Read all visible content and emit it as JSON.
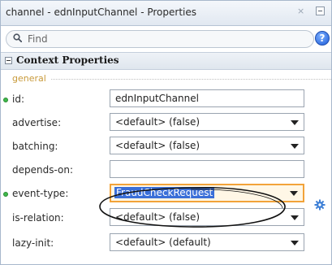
{
  "window": {
    "title": "channel - ednInputChannel - Properties",
    "close_glyph": "×",
    "max_icon": "maximize-icon"
  },
  "search": {
    "placeholder": "Find",
    "icon": "search-icon",
    "help_glyph": "?"
  },
  "section": {
    "title": "Context Properties",
    "collapse_icon": "collapse-icon"
  },
  "group": {
    "label": "general"
  },
  "properties": [
    {
      "label": "id:",
      "value": "ednInputChannel",
      "type": "text",
      "required": true
    },
    {
      "label": "advertise:",
      "value": "<default> (false)",
      "type": "dropdown",
      "required": false
    },
    {
      "label": "batching:",
      "value": "<default> (false)",
      "type": "dropdown",
      "required": false
    },
    {
      "label": "depends-on:",
      "value": "",
      "type": "text",
      "required": false
    },
    {
      "label": "event-type:",
      "value": "FraudCheckRequest",
      "type": "dropdown",
      "required": true,
      "focused": true,
      "selected": true
    },
    {
      "label": "is-relation:",
      "value": "<default> (false)",
      "type": "dropdown",
      "required": false
    },
    {
      "label": "lazy-init:",
      "value": "<default> (default)",
      "type": "dropdown",
      "required": false
    }
  ],
  "colors": {
    "required_dot": "#3fb94a",
    "focus_border": "#f2a33a",
    "selection_bg": "#3a6fd8",
    "group_label": "#c89a3a",
    "help_icon": "#1c5ad8"
  },
  "icons": {
    "event_type_action": "gear-icon",
    "annotation": "hand-drawn-ellipse"
  }
}
